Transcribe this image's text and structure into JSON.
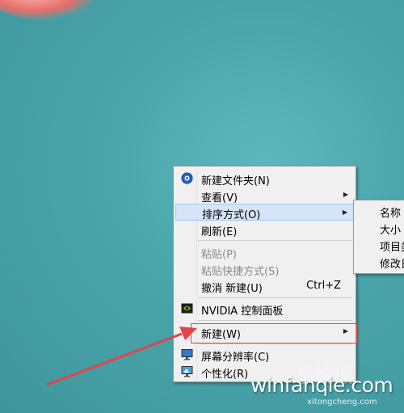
{
  "context_menu": {
    "items": [
      {
        "label": "新建文件夹(N)",
        "shortcut": "",
        "submenu": false,
        "disabled": false,
        "icon": "folder-badge-icon"
      },
      {
        "label": "查看(V)",
        "shortcut": "",
        "submenu": true,
        "disabled": false
      },
      {
        "label": "排序方式(O)",
        "shortcut": "",
        "submenu": true,
        "disabled": false,
        "highlighted": true
      },
      {
        "label": "刷新(E)",
        "shortcut": "",
        "submenu": false,
        "disabled": false
      },
      {
        "label": "粘贴(P)",
        "shortcut": "",
        "submenu": false,
        "disabled": true
      },
      {
        "label": "粘贴快捷方式(S)",
        "shortcut": "",
        "submenu": false,
        "disabled": true
      },
      {
        "label": "撤消 新建(U)",
        "shortcut": "Ctrl+Z",
        "submenu": false,
        "disabled": false
      },
      {
        "label": "NVIDIA 控制面板",
        "shortcut": "",
        "submenu": false,
        "disabled": false,
        "icon": "nvidia-icon"
      },
      {
        "label": "新建(W)",
        "shortcut": "",
        "submenu": true,
        "disabled": false
      },
      {
        "label": "屏幕分辨率(C)",
        "shortcut": "",
        "submenu": false,
        "disabled": false,
        "icon": "monitor-icon"
      },
      {
        "label": "个性化(R)",
        "shortcut": "",
        "submenu": false,
        "disabled": false,
        "icon": "personalize-icon"
      }
    ]
  },
  "sort_submenu": {
    "items": [
      "名称",
      "大小",
      "项目类",
      "修改日"
    ]
  },
  "watermark": {
    "text": "winfanqie.com",
    "sub": "xitongcheng.com",
    "ghost": "系统城"
  },
  "colors": {
    "highlight": "#d5e4f7",
    "annotation": "#e0454a",
    "desktop": "#49a4aa"
  }
}
